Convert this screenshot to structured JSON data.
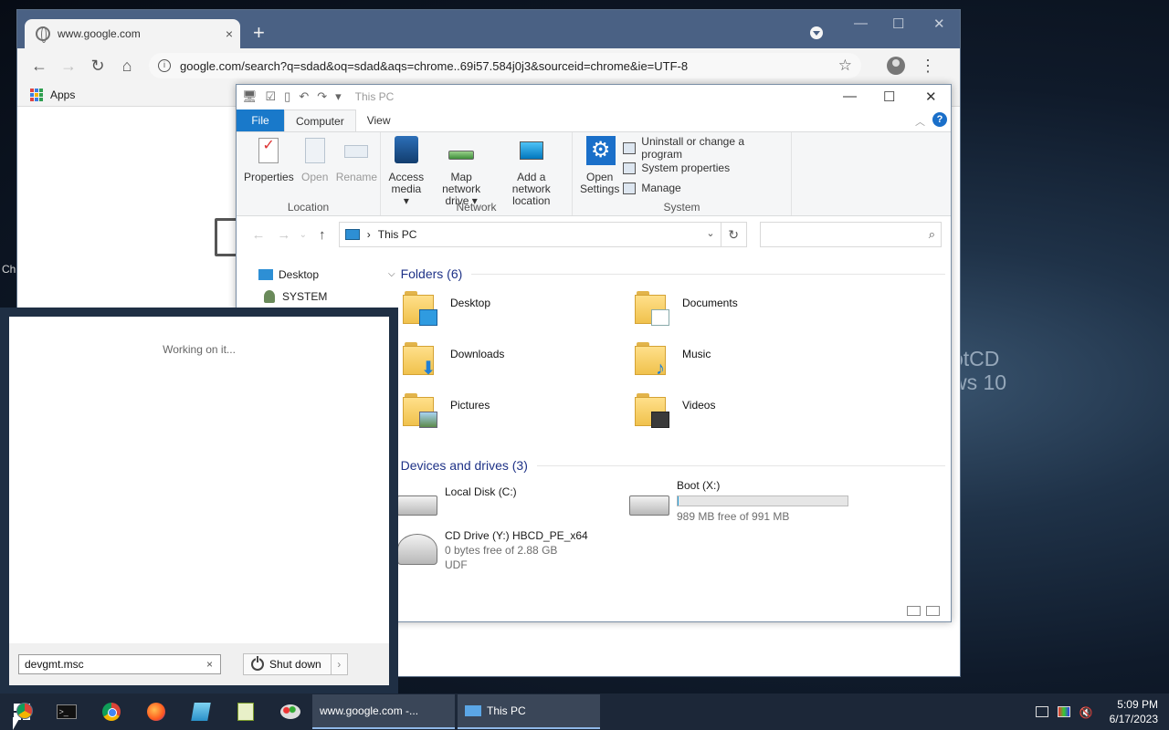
{
  "desktop": {
    "wallpaper_lines": [
      "otCD",
      "ws 10"
    ],
    "left_stub": "Ch"
  },
  "chrome": {
    "tab_title": "www.google.com",
    "tab_close": "×",
    "new_tab": "+",
    "url": "google.com/search?q=sdad&oq=sdad&aqs=chrome..69i57.584j0j3&sourceid=chrome&ie=UTF-8",
    "bookmarks_apps": "Apps"
  },
  "explorer": {
    "title": "This PC",
    "tabs": {
      "file": "File",
      "computer": "Computer",
      "view": "View"
    },
    "help": "?",
    "ribbon": {
      "location": {
        "label": "Location",
        "properties": "Properties",
        "open": "Open",
        "rename": "Rename"
      },
      "network": {
        "label": "Network",
        "access_media": [
          "Access",
          "media ▾"
        ],
        "map_drive": [
          "Map network",
          "drive ▾"
        ],
        "add_location": [
          "Add a network",
          "location"
        ]
      },
      "system": {
        "label": "System",
        "open_settings": [
          "Open",
          "Settings"
        ],
        "uninstall": "Uninstall or change a program",
        "system_properties": "System properties",
        "manage": "Manage"
      }
    },
    "address": {
      "path": "This PC",
      "separator": "›"
    },
    "nav_pane": [
      "Desktop",
      "SYSTEM"
    ],
    "folders_header": "Folders (6)",
    "folders": [
      "Desktop",
      "Documents",
      "Downloads",
      "Music",
      "Pictures",
      "Videos"
    ],
    "drives_header": "Devices and drives (3)",
    "drives": {
      "c": {
        "name": "Local Disk (C:)"
      },
      "x": {
        "name": "Boot (X:)",
        "free": "989 MB free of 991 MB",
        "used_fraction": 0.002
      },
      "y": {
        "name": "CD Drive (Y:) HBCD_PE_x64",
        "free": "0 bytes free of 2.88 GB",
        "fs": "UDF"
      }
    }
  },
  "start": {
    "status": "Working on it...",
    "search_value": "devgmt.msc",
    "clear": "×",
    "shutdown": "Shut down",
    "shutdown_arrow": "›"
  },
  "taskbar": {
    "windows": [
      "www.google.com -...",
      "This PC"
    ],
    "time": "5:09 PM",
    "date": "6/17/2023"
  },
  "colors": {
    "accent": "#1979ca",
    "taskbar": "#1c2738",
    "chrome_frame": "#4a6184",
    "section_header": "#1e3287"
  }
}
